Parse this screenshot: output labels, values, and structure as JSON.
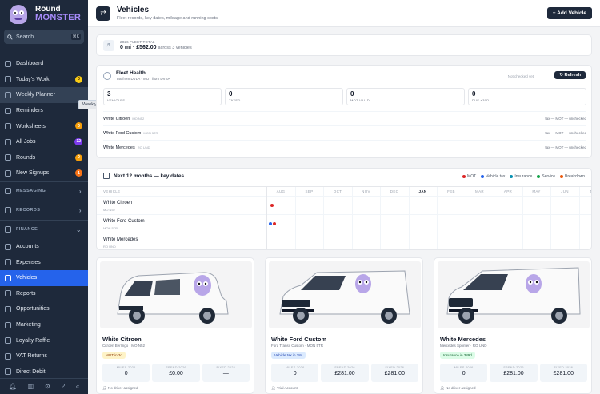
{
  "brand": {
    "line1": "Round",
    "line2": "MONSTER"
  },
  "search": {
    "placeholder": "Search...",
    "shortcut": "⌘K"
  },
  "nav": {
    "items": [
      {
        "label": "Dashboard",
        "badge": ""
      },
      {
        "label": "Today's Work",
        "badge": "0",
        "badge_color": "#facc15"
      },
      {
        "label": "Weekly Planner",
        "badge": ""
      },
      {
        "label": "Reminders",
        "badge": ""
      },
      {
        "label": "Worksheets",
        "badge": "0",
        "badge_color": "#f59e0b"
      },
      {
        "label": "All Jobs",
        "badge": "12",
        "badge_color": "#7c3aed"
      },
      {
        "label": "Rounds",
        "badge": "0",
        "badge_color": "#f59e0b"
      },
      {
        "label": "New Signups",
        "badge": "1",
        "badge_color": "#f97316"
      }
    ],
    "sections": {
      "messaging": "MESSAGING",
      "records": "RECORDS",
      "finance": "FINANCE"
    },
    "finance_items": [
      "Accounts",
      "Expenses",
      "Vehicles",
      "Reports",
      "Opportunities",
      "Marketing",
      "Loyalty Raffle",
      "VAT Returns",
      "Direct Debit"
    ],
    "tooltip": "Weekly Planner"
  },
  "header": {
    "title": "Vehicles",
    "subtitle": "Fleet records, key dates, mileage and running costs",
    "add_button": "+ Add Vehicle"
  },
  "fleet_total": {
    "label": "2026 FLEET TOTAL",
    "miles": "0 mi",
    "amount": "£562.00",
    "suffix": "across 3 vehicles"
  },
  "health": {
    "title": "Fleet Health",
    "subtitle": "Tax from DVLA · MOT from DVSA",
    "not_checked": "Not checked yet",
    "refresh": "Refresh",
    "stats": [
      {
        "value": "3",
        "label": "VEHICLES"
      },
      {
        "value": "0",
        "label": "TAXED"
      },
      {
        "value": "0",
        "label": "MOT VALID"
      },
      {
        "value": "0",
        "label": "DUE ≤30D"
      }
    ],
    "rows": [
      {
        "name": "White Citroen",
        "reg": "MO N52",
        "status": "tax —  MOT —  unchecked"
      },
      {
        "name": "White Ford Custom",
        "reg": "MON 5TR",
        "status": "tax —  MOT —  unchecked"
      },
      {
        "name": "White Mercedes",
        "reg": "RO UND",
        "status": "tax —  MOT —  unchecked"
      }
    ]
  },
  "calendar": {
    "title": "Next 12 months — key dates",
    "legend": [
      {
        "label": "MOT",
        "color": "#dc2626"
      },
      {
        "label": "Vehicle tax",
        "color": "#2563eb"
      },
      {
        "label": "Insurance",
        "color": "#0891b2"
      },
      {
        "label": "Service",
        "color": "#16a34a"
      },
      {
        "label": "Breakdown",
        "color": "#ea580c"
      }
    ],
    "col_vehicle": "VEHICLE",
    "months": [
      "AUG",
      "SEP",
      "OCT",
      "NOV",
      "DEC",
      "JAN",
      "FEB",
      "MAR",
      "APR",
      "MAY",
      "JUN",
      "JUL"
    ],
    "current_month": "JAN",
    "rows": [
      {
        "name": "White Citroen",
        "reg": "MO N52"
      },
      {
        "name": "White Ford Custom",
        "reg": "MON 5TR"
      },
      {
        "name": "White Mercedes",
        "reg": "RO UND"
      }
    ]
  },
  "vehicles": [
    {
      "name": "White Citroen",
      "sub": "Citroen Berlingo · MO N52",
      "badge": "MOT in 3d",
      "badge_bg": "#fef3c7",
      "badge_fg": "#92400e",
      "stats": [
        {
          "label": "MILES 2026",
          "value": "0"
        },
        {
          "label": "SPEND 2026",
          "value": "£0.00"
        },
        {
          "label": "FIXED 2026",
          "value": "—"
        }
      ],
      "driver": "No driver assigned"
    },
    {
      "name": "White Ford Custom",
      "sub": "Ford Transit Custom · MON 5TR",
      "badge": "Vehicle tax in 18d",
      "badge_bg": "#dbeafe",
      "badge_fg": "#1e40af",
      "stats": [
        {
          "label": "MILES 2026",
          "value": "0"
        },
        {
          "label": "SPEND 2026",
          "value": "£281.00"
        },
        {
          "label": "FIXED 2026",
          "value": "£281.00"
        }
      ],
      "driver": "Trial Account"
    },
    {
      "name": "White Mercedes",
      "sub": "Mercedes Sprinter · RO UND",
      "badge": "Insurance in 389d",
      "badge_bg": "#dcfce7",
      "badge_fg": "#166534",
      "stats": [
        {
          "label": "MILES 2026",
          "value": "0"
        },
        {
          "label": "SPEND 2026",
          "value": "£281.00"
        },
        {
          "label": "FIXED 2026",
          "value": "£281.00"
        }
      ],
      "driver": "No driver assigned"
    }
  ]
}
